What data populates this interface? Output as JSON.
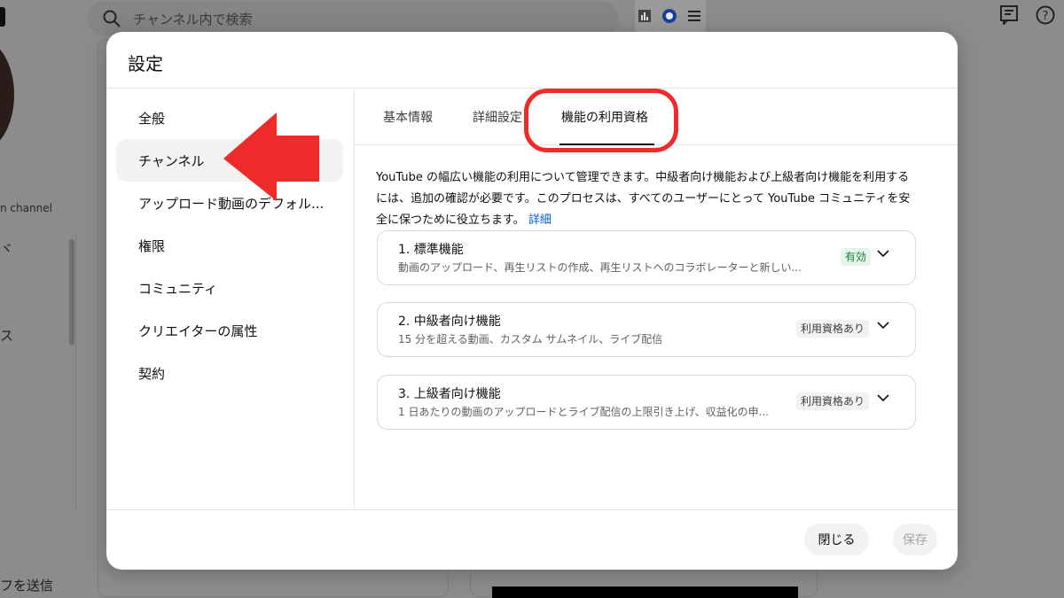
{
  "background": {
    "search_placeholder": "チャンネル内で検索",
    "channel_fragment": "n channel",
    "nav_fragments": [
      "ヾ",
      "ス"
    ],
    "feedback_fragment": "フを送信"
  },
  "modal": {
    "title": "設定",
    "nav_items": [
      {
        "label": "全般"
      },
      {
        "label": "チャンネル"
      },
      {
        "label": "アップロード動画のデフォル..."
      },
      {
        "label": "権限"
      },
      {
        "label": "コミュニティ"
      },
      {
        "label": "クリエイターの属性"
      },
      {
        "label": "契約"
      }
    ],
    "tabs": [
      {
        "label": "基本情報"
      },
      {
        "label": "詳細設定"
      },
      {
        "label": "機能の利用資格"
      }
    ],
    "description": {
      "text": "YouTube の幅広い機能の利用について管理できます。中級者向け機能および上級者向け機能を利用するには、追加の確認が必要です。このプロセスは、すべてのユーザーにとって YouTube コミュニティを安全に保つために役立ちます。",
      "link": "詳細"
    },
    "features": [
      {
        "title": "1. 標準機能",
        "subtitle": "動画のアップロード、再生リストの作成、再生リストへのコラボレーターと新しい...",
        "badge": "有効"
      },
      {
        "title": "2. 中級者向け機能",
        "subtitle": "15 分を超える動画、カスタム サムネイル、ライブ配信",
        "badge": "利用資格あり"
      },
      {
        "title": "3. 上級者向け機能",
        "subtitle": "1 日あたりの動画のアップロードとライブ配信の上限引き上げ、収益化の申...",
        "badge": "利用資格あり"
      }
    ],
    "buttons": {
      "close": "閉じる",
      "save": "保存"
    }
  },
  "colors": {
    "highlight": "#ee2a2a",
    "link": "#065fd4",
    "badge_enabled_bg": "#e6f4ea",
    "badge_enabled_text": "#188038"
  }
}
